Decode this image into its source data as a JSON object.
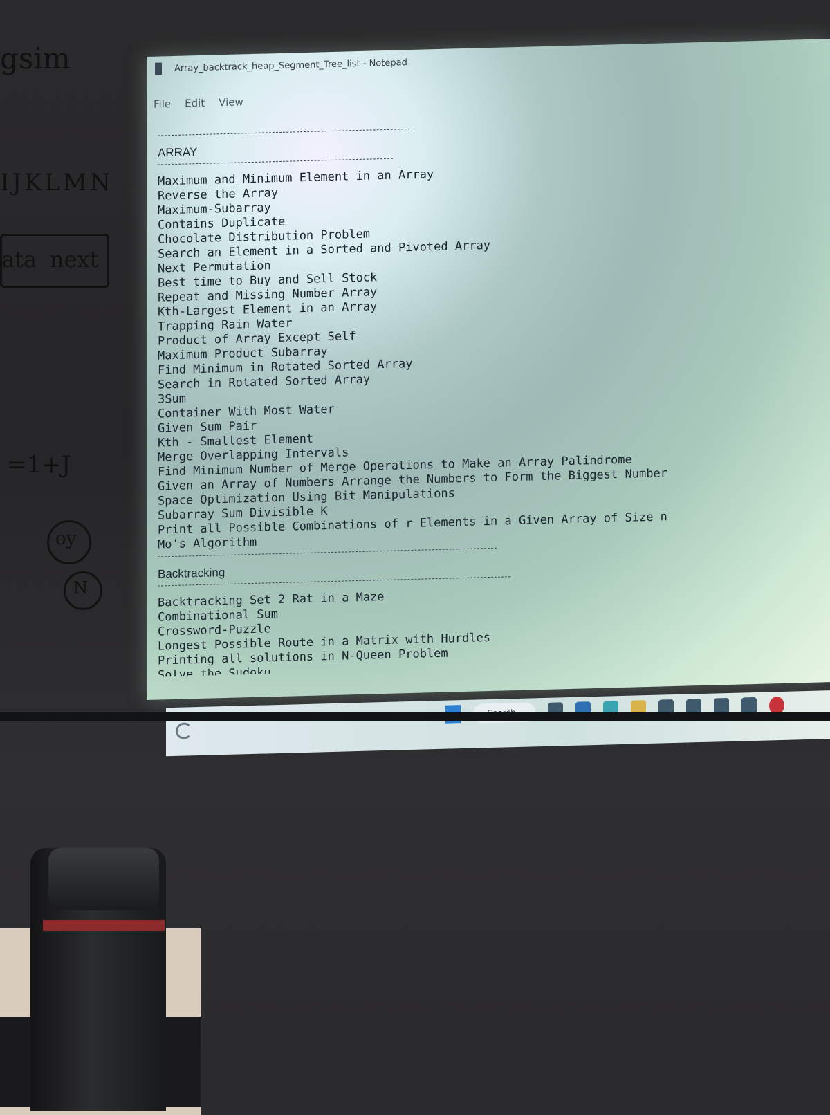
{
  "window": {
    "title": "Array_backtrack_heap_Segment_Tree_list - Notepad"
  },
  "menu": {
    "file": "File",
    "edit": "Edit",
    "view": "View"
  },
  "content": {
    "array_heading": "ARRAY",
    "array_items": [
      "Maximum and Minimum Element in an Array",
      "Reverse the Array",
      "Maximum-Subarray",
      "Contains Duplicate",
      "Chocolate Distribution Problem",
      "Search an Element in a Sorted and Pivoted Array",
      "Next Permutation",
      "Best time to Buy and Sell Stock",
      "Repeat and Missing Number Array",
      "Kth-Largest Element in an Array",
      "Trapping Rain Water",
      "Product of Array Except Self",
      "Maximum Product Subarray",
      "Find Minimum in Rotated Sorted Array",
      "Search in Rotated Sorted Array",
      "3Sum",
      "Container With Most Water",
      "Given Sum Pair",
      "Kth - Smallest Element",
      "Merge Overlapping Intervals",
      "Find Minimum Number of Merge Operations to Make an Array Palindrome",
      "Given an Array of Numbers Arrange the Numbers to Form the Biggest Number",
      "Space Optimization Using Bit Manipulations",
      "Subarray Sum Divisible K",
      "Print all Possible Combinations of r Elements in a Given Array of Size n",
      "Mo's Algorithm"
    ],
    "backtracking_heading": "Backtracking",
    "backtracking_items": [
      "Backtracking Set 2 Rat in a Maze",
      "Combinational Sum",
      "Crossword-Puzzle",
      "Longest Possible Route in a Matrix with Hurdles",
      "Printing all solutions in N-Queen Problem",
      "Solve the Sudoku"
    ]
  },
  "taskbar": {
    "search_label": "Search"
  },
  "whiteboard": {
    "top_text": "gsim",
    "letters": "IJKLMN",
    "box_left": "ata",
    "box_right": "next",
    "formula": "=1+J",
    "circle_1": "oy",
    "circle_2": "N"
  }
}
